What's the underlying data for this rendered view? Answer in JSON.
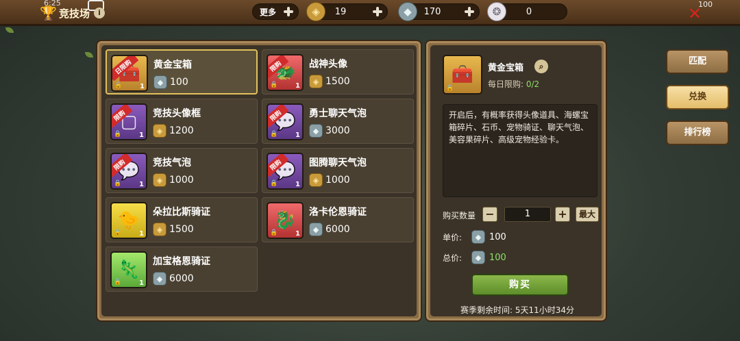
{
  "status_bar": {
    "time": "6:25",
    "battery": "100"
  },
  "header": {
    "title": "竞技场",
    "more_label": "更多",
    "resources": [
      {
        "icon": "gold-coin-icon",
        "value": "19"
      },
      {
        "icon": "crystal-icon",
        "value": "170"
      },
      {
        "icon": "shell-icon",
        "value": "0"
      }
    ]
  },
  "shop_items": [
    {
      "name": "黄金宝箱",
      "price": "100",
      "currency": "crystal",
      "tag": "日限购",
      "count": "1",
      "icon": "treasure-chest-icon",
      "theme": "gold",
      "selected": true
    },
    {
      "name": "战神头像",
      "price": "1500",
      "currency": "gold",
      "tag": "限购",
      "count": "1",
      "icon": "red-dragon-avatar-icon",
      "theme": "red"
    },
    {
      "name": "竞技头像框",
      "price": "1200",
      "currency": "gold",
      "tag": "限购",
      "count": "1",
      "icon": "avatar-frame-icon",
      "theme": "purple"
    },
    {
      "name": "勇士聊天气泡",
      "price": "3000",
      "currency": "crystal",
      "tag": "限购",
      "count": "1",
      "icon": "chat-bubble-icon",
      "theme": "purple"
    },
    {
      "name": "竞技气泡",
      "price": "1000",
      "currency": "gold",
      "tag": "限购",
      "count": "1",
      "icon": "chat-bubble-icon",
      "theme": "purple"
    },
    {
      "name": "图腾聊天气泡",
      "price": "1000",
      "currency": "gold",
      "tag": "限购",
      "count": "1",
      "icon": "chat-bubble-icon",
      "theme": "purple"
    },
    {
      "name": "朵拉比斯骑证",
      "price": "1500",
      "currency": "gold",
      "tag": "",
      "count": "1",
      "icon": "yellow-mount-icon",
      "theme": "yellow"
    },
    {
      "name": "洛卡伦恩骑证",
      "price": "6000",
      "currency": "crystal",
      "tag": "",
      "count": "1",
      "icon": "red-mount-icon",
      "theme": "red"
    },
    {
      "name": "加宝格恩骑证",
      "price": "6000",
      "currency": "crystal",
      "tag": "",
      "count": "1",
      "icon": "green-mount-icon",
      "theme": "green"
    }
  ],
  "detail": {
    "name": "黄金宝箱",
    "limit_label": "每日限购:",
    "limit_value": "0/2",
    "description": "开启后，有概率获得头像道具、海螺宝箱碎片、石币、宠物骑证、聊天气泡、美容果碎片、高级宠物经验卡。",
    "quantity_label": "购买数量",
    "quantity": "1",
    "max_label": "最大",
    "unit_price_label": "单价:",
    "unit_price": "100",
    "total_price_label": "总价:",
    "total_price": "100",
    "buy_label": "购买",
    "season_label": "赛季剩余时间:",
    "season_value": "5天11小时34分"
  },
  "side_tabs": [
    {
      "label": "匹配",
      "active": false
    },
    {
      "label": "兑换",
      "active": true
    },
    {
      "label": "排行榜",
      "active": false
    }
  ],
  "colors": {
    "accent_gold": "#e2c15c",
    "limit_green": "#8ee06a",
    "buy_green": "#7aa83c",
    "tag_red": "#d22b2b",
    "close_red": "#d8231c"
  }
}
